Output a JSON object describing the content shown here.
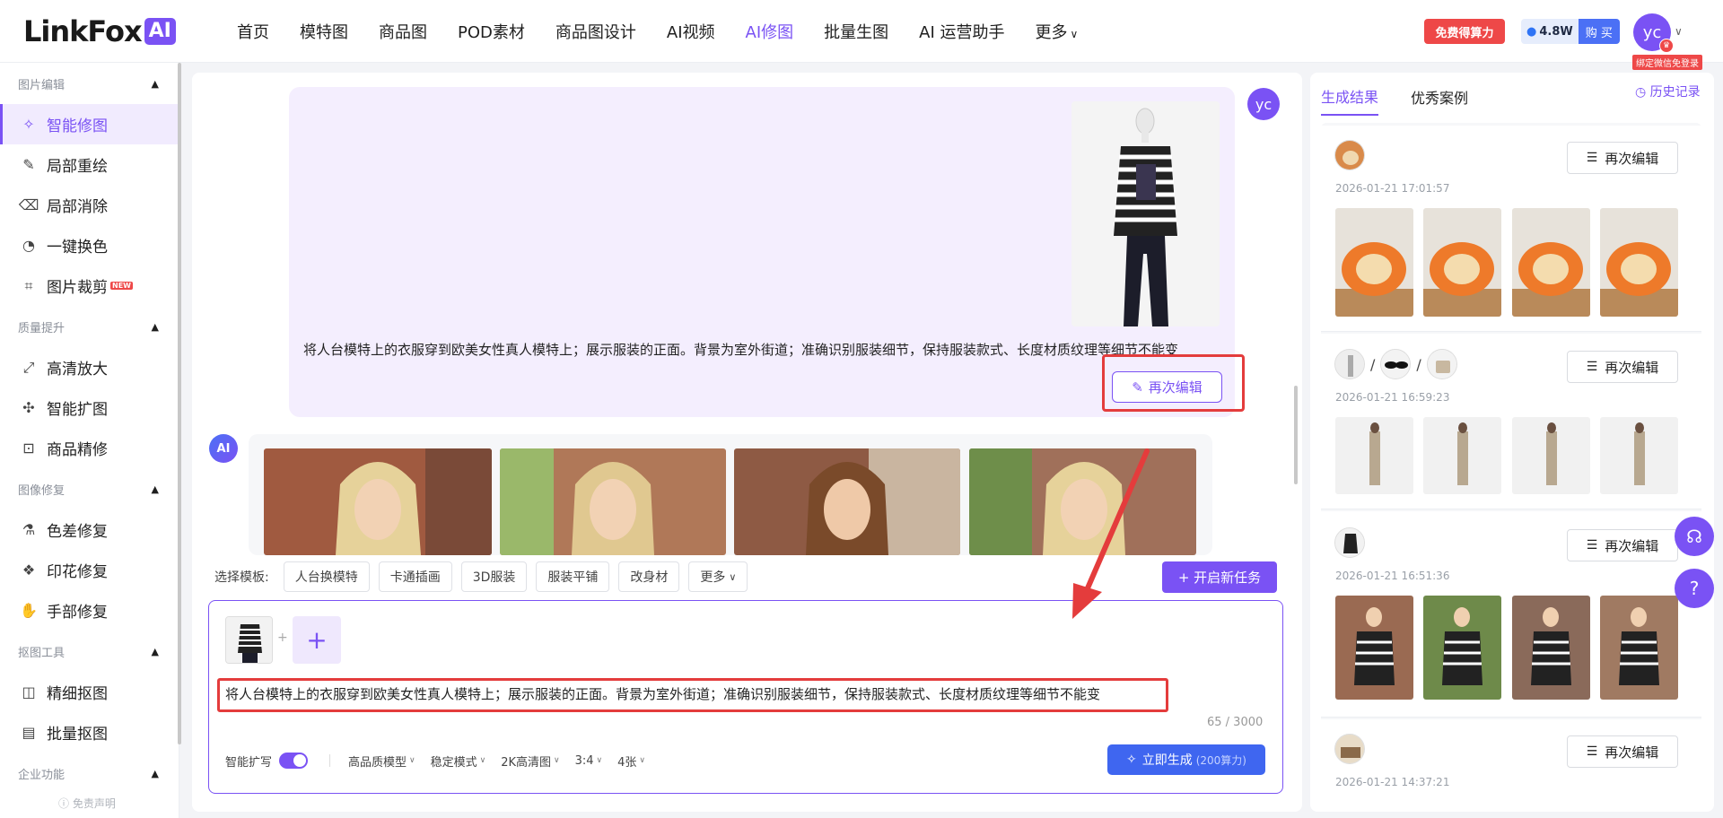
{
  "brand": {
    "name": "LinkFox",
    "badge": "AI"
  },
  "nav": {
    "items": [
      "首页",
      "模特图",
      "商品图",
      "POD素材",
      "商品图设计",
      "AI视频",
      "AI修图",
      "批量生图",
      "AI 运营助手"
    ],
    "more": "更多",
    "active_index": 6
  },
  "header": {
    "free_label": "免费得算力",
    "credits": "4.8W",
    "buy_label": "购 买",
    "avatar": "yc",
    "bind_badge": "绑定微信免登录"
  },
  "sidebar": {
    "sections": [
      {
        "title": "图片编辑",
        "items": [
          {
            "label": "智能修图",
            "icon": "magic-wand-icon",
            "active": true
          },
          {
            "label": "局部重绘",
            "icon": "brush-icon"
          },
          {
            "label": "局部消除",
            "icon": "eraser-icon"
          },
          {
            "label": "一键换色",
            "icon": "palette-icon"
          },
          {
            "label": "图片裁剪",
            "icon": "crop-icon",
            "badge": "NEW"
          }
        ]
      },
      {
        "title": "质量提升",
        "items": [
          {
            "label": "高清放大",
            "icon": "upscale-icon"
          },
          {
            "label": "智能扩图",
            "icon": "expand-icon"
          },
          {
            "label": "商品精修",
            "icon": "retouch-icon"
          }
        ]
      },
      {
        "title": "图像修复",
        "items": [
          {
            "label": "色差修复",
            "icon": "color-fix-icon"
          },
          {
            "label": "印花修复",
            "icon": "print-fix-icon"
          },
          {
            "label": "手部修复",
            "icon": "hand-icon"
          }
        ]
      },
      {
        "title": "抠图工具",
        "items": [
          {
            "label": "精细抠图",
            "icon": "cutout-icon"
          },
          {
            "label": "批量抠图",
            "icon": "batch-cutout-icon"
          }
        ]
      },
      {
        "title": "企业功能",
        "items": []
      }
    ],
    "disclaimer": "ⓘ 免责声明"
  },
  "chat": {
    "user_avatar": "yc",
    "user_prompt": "将人台模特上的衣服穿到欧美女性真人模特上；展示服装的正面。背景为室外街道；准确识别服装细节，保持服装款式、长度材质纹理等细节不能变",
    "reedit_label": "再次编辑",
    "ai_avatar": "AI"
  },
  "templates": {
    "label": "选择模板:",
    "items": [
      "人台换模特",
      "卡通插画",
      "3D服装",
      "服装平铺",
      "改身材"
    ],
    "more": "更多",
    "new_task": "+ 开启新任务"
  },
  "composer": {
    "prompt": "将人台模特上的衣服穿到欧美女性真人模特上；展示服装的正面。背景为室外街道；准确识别服装细节，保持服装款式、长度材质纹理等细节不能变",
    "counter": "65 / 3000",
    "smart_expand": "智能扩写",
    "options": [
      "高品质模型",
      "稳定模式",
      "2K高清图",
      "3:4",
      "4张"
    ],
    "generate": "立即生成",
    "generate_cost": "(200算力)"
  },
  "results": {
    "tabs": [
      "生成结果",
      "优秀案例"
    ],
    "history": "历史记录",
    "edit_label": "再次编辑",
    "cards": [
      {
        "time": "2026-01-21 17:01:57"
      },
      {
        "time": "2026-01-21 16:59:23"
      },
      {
        "time": "2026-01-21 16:51:36"
      },
      {
        "time": "2026-01-21 14:37:21"
      }
    ]
  }
}
